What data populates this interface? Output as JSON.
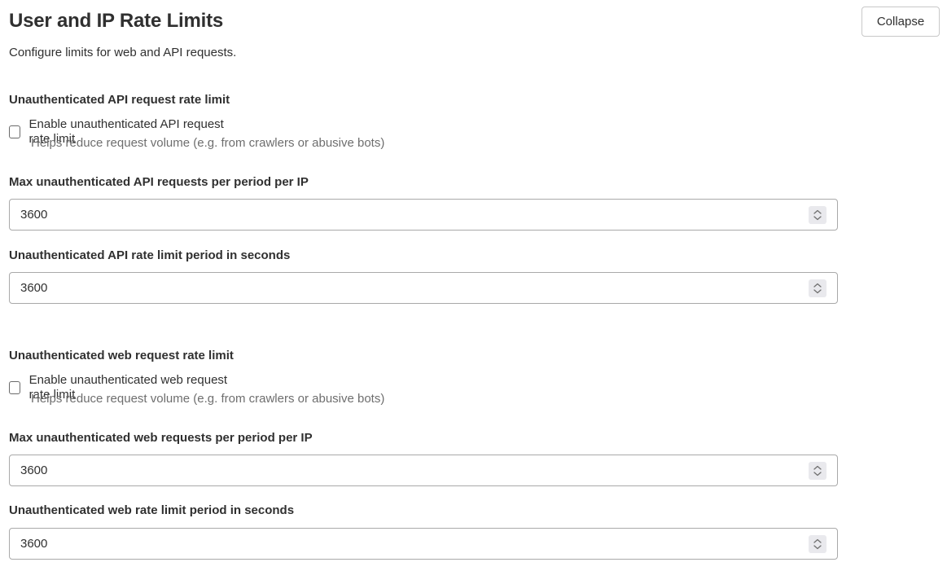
{
  "header": {
    "title": "User and IP Rate Limits",
    "subtitle": "Configure limits for web and API requests.",
    "collapse_label": "Collapse"
  },
  "api_section": {
    "heading": "Unauthenticated API request rate limit",
    "checkbox_label": "Enable unauthenticated API request rate limit",
    "checkbox_checked": false,
    "help_text": "Helps reduce request volume (e.g. from crawlers or abusive bots)",
    "max_requests": {
      "label": "Max unauthenticated API requests per period per IP",
      "value": "3600"
    },
    "period": {
      "label": "Unauthenticated API rate limit period in seconds",
      "value": "3600"
    }
  },
  "web_section": {
    "heading": "Unauthenticated web request rate limit",
    "checkbox_label": "Enable unauthenticated web request rate limit",
    "checkbox_checked": false,
    "help_text": "Helps reduce request volume (e.g. from crawlers or abusive bots)",
    "max_requests": {
      "label": "Max unauthenticated web requests per period per IP",
      "value": "3600"
    },
    "period": {
      "label": "Unauthenticated web rate limit period in seconds",
      "value": "3600"
    }
  },
  "icons": {
    "spinner": "spinner-updown-icon"
  }
}
